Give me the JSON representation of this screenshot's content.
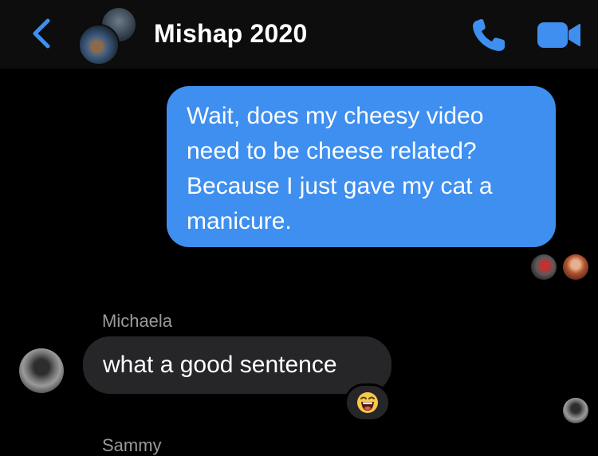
{
  "header": {
    "title": "Mishap 2020",
    "back_icon": "chevron-left-icon",
    "call_icon": "phone-icon",
    "video_icon": "video-camera-icon",
    "accent_color": "#3e8ff0"
  },
  "messages": [
    {
      "direction": "outgoing",
      "lines": [
        "Wait, does my cheesy video",
        "need to be cheese related?",
        "Because I just gave my cat a",
        "manicure."
      ],
      "bubble_color": "#3e8ff0"
    },
    {
      "direction": "incoming",
      "sender": "Michaela",
      "text": "what a good sentence",
      "reaction": "laughing-emoji",
      "bubble_color": "#262628"
    }
  ],
  "next_sender": "Sammy"
}
